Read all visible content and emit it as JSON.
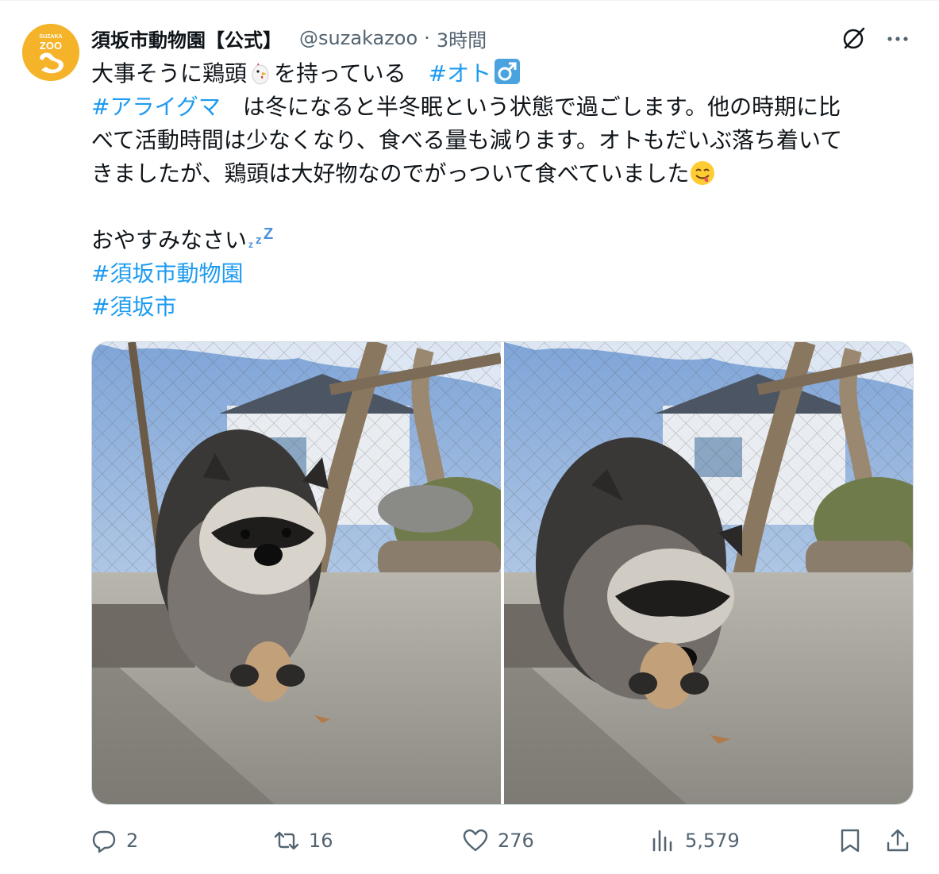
{
  "tweet": {
    "author": {
      "display_name": "須坂市動物園【公式】",
      "handle": "@suzakazoo",
      "avatar_text": "SUZAKA ZOO",
      "avatar_color": "#f5b32a"
    },
    "separator": "·",
    "time": "3時間",
    "text": {
      "line1_a": "大事そうに鶏頭",
      "line1_b": "を持っている　",
      "line1_tag": "#オト",
      "line2_tag": "#アライグマ",
      "line2_rest": "　は冬になると半冬眠という状態で過ごします。他の時期に比",
      "line3": "べて活動時間は少なくなり、食べる量も減ります。オトもだいぶ落ち着いて",
      "line4": "きましたが、鶏頭は大好物なのでがっついて食べていました",
      "line6": "おやすみなさい",
      "tag_zoo": "#須坂市動物園",
      "tag_city": "#須坂市"
    },
    "emojis": [
      "chicken-emoji",
      "male-sign-emoji",
      "yum-face-emoji",
      "zzz-emoji"
    ],
    "media": [
      "raccoon-looking-photo",
      "raccoon-eating-photo"
    ],
    "actions": {
      "replies": "2",
      "retweets": "16",
      "likes": "276",
      "views": "5,579"
    }
  },
  "colors": {
    "link": "#1d9bf0",
    "muted": "#536471",
    "text": "#0f1419",
    "border": "#cfd9de"
  }
}
